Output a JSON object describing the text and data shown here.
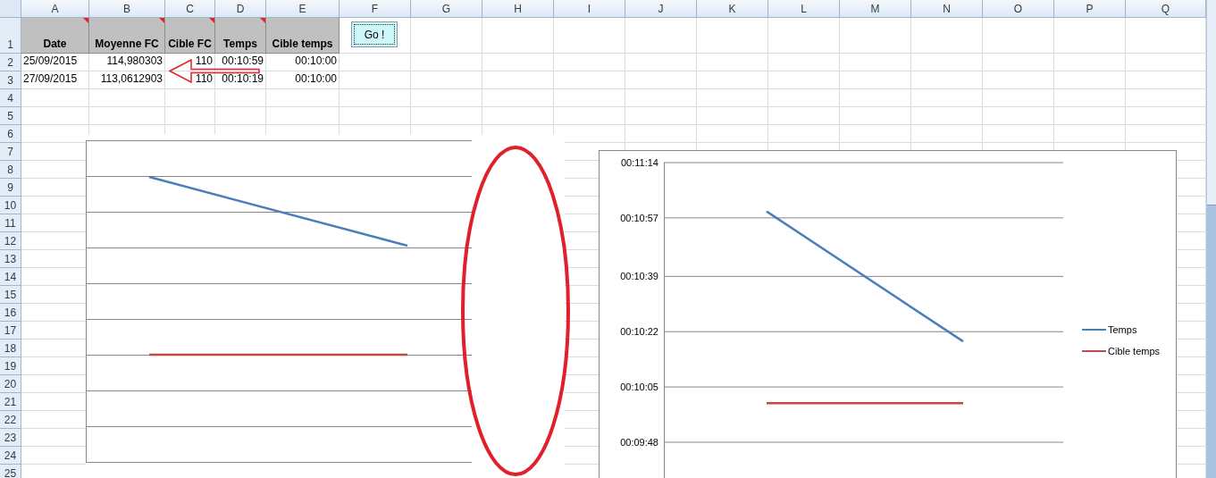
{
  "columns": [
    "A",
    "B",
    "C",
    "D",
    "E",
    "F",
    "G",
    "H",
    "I",
    "J",
    "K",
    "L",
    "M",
    "N",
    "O",
    "P",
    "Q"
  ],
  "header_row": {
    "number": "1",
    "cells": [
      {
        "text": "Date",
        "comment": true
      },
      {
        "text": "Moyenne FC",
        "comment": true
      },
      {
        "text": "Cible FC",
        "comment": true
      },
      {
        "text": "Temps",
        "comment": true
      },
      {
        "text": "Cible temps",
        "comment": false
      }
    ]
  },
  "go_button": {
    "label": "Go !"
  },
  "data_rows": [
    {
      "number": "2",
      "cells": [
        "25/09/2015",
        "114,980303",
        "110",
        "00:10:59",
        "00:10:00"
      ]
    },
    {
      "number": "3",
      "cells": [
        "27/09/2015",
        "113,0612903",
        "110",
        "00:10:19",
        "00:10:00"
      ]
    }
  ],
  "empty_rows": [
    "4",
    "5",
    "6",
    "7",
    "8",
    "9",
    "10",
    "11",
    "12",
    "13",
    "14",
    "15",
    "16",
    "17",
    "18",
    "19",
    "20",
    "21",
    "22",
    "23",
    "24",
    "25"
  ],
  "time_chart": {
    "chart_data": {
      "type": "line",
      "grid": true,
      "legend": true,
      "ylim": [
        577,
        674
      ],
      "yticks": [
        {
          "value": 674,
          "label": "00:11:14"
        },
        {
          "value": 657,
          "label": "00:10:57"
        },
        {
          "value": 639,
          "label": "00:10:39"
        },
        {
          "value": 622,
          "label": "00:10:22"
        },
        {
          "value": 605,
          "label": "00:10:05"
        },
        {
          "value": 588,
          "label": "00:09:48"
        }
      ],
      "series": [
        {
          "name": "Temps",
          "color": "#4a7ebb",
          "values": [
            659,
            619
          ]
        },
        {
          "name": "Cible temps",
          "color": "#be4b48",
          "values": [
            600,
            600
          ]
        }
      ]
    }
  }
}
